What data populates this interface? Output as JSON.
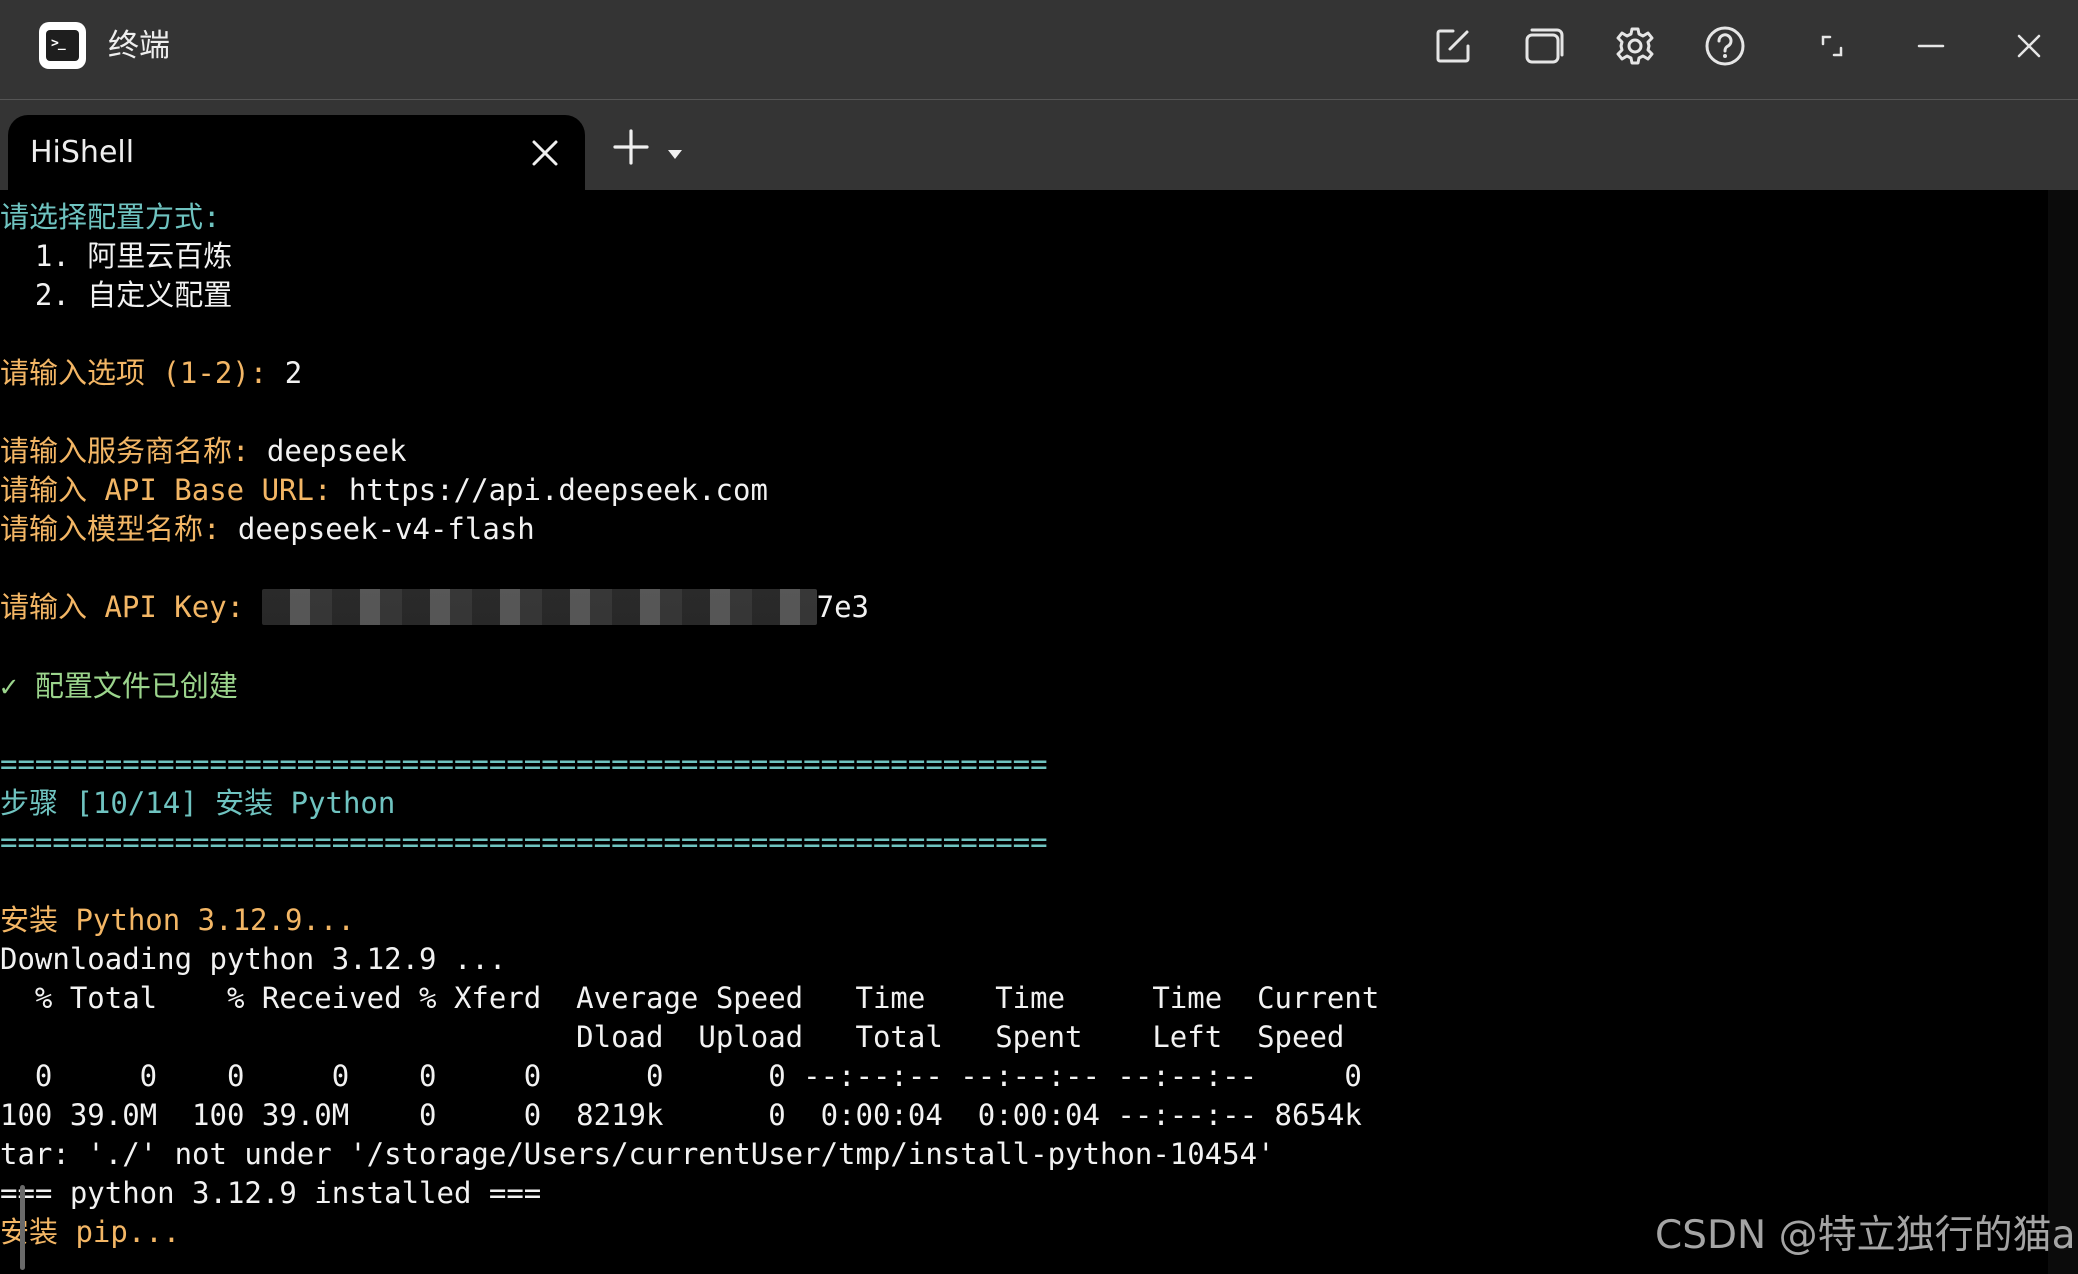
{
  "window": {
    "title": "终端",
    "icons": [
      "terminal-app-icon",
      "edit-square-icon",
      "window-duplicate-icon",
      "gear-icon",
      "help-circle-icon",
      "restore-window-icon",
      "minimize-icon",
      "close-icon"
    ]
  },
  "app_logo": {
    "prompt": ">_"
  },
  "tabs": [
    {
      "label": "HiShell"
    }
  ],
  "terminal": {
    "colors": {
      "cyan": "#6fc3c0",
      "orange": "#f3b665",
      "green": "#9bd48c",
      "white": "#f2f2f2"
    },
    "lines": [
      {
        "segments": [
          {
            "text": "请选择配置方式:",
            "color": "cyan"
          }
        ]
      },
      {
        "segments": [
          {
            "text": "  1. 阿里云百炼",
            "color": "white"
          }
        ]
      },
      {
        "segments": [
          {
            "text": "  2. 自定义配置",
            "color": "white"
          }
        ]
      },
      {
        "segments": []
      },
      {
        "segments": [
          {
            "text": "请输入选项 (1-2): ",
            "color": "orange"
          },
          {
            "text": "2",
            "color": "white"
          }
        ]
      },
      {
        "segments": []
      },
      {
        "segments": [
          {
            "text": "请输入服务商名称: ",
            "color": "orange"
          },
          {
            "text": "deepseek",
            "color": "white"
          }
        ]
      },
      {
        "segments": [
          {
            "text": "请输入 API Base URL: ",
            "color": "orange"
          },
          {
            "text": "https://api.deepseek.com",
            "color": "white"
          }
        ]
      },
      {
        "segments": [
          {
            "text": "请输入模型名称: ",
            "color": "orange"
          },
          {
            "text": "deepseek-v4-flash",
            "color": "white"
          }
        ]
      },
      {
        "segments": []
      },
      {
        "segments": [
          {
            "text": "请输入 API Key: ",
            "color": "orange"
          },
          {
            "text": "",
            "color": "white",
            "redacted": true
          },
          {
            "text": "7e3",
            "color": "white"
          }
        ]
      },
      {
        "segments": []
      },
      {
        "segments": [
          {
            "text": "✓ 配置文件已创建",
            "color": "green"
          }
        ]
      },
      {
        "segments": []
      },
      {
        "segments": [
          {
            "text": "============================================================",
            "color": "cyan"
          }
        ]
      },
      {
        "segments": [
          {
            "text": "步骤 [10/14] 安装 Python",
            "color": "cyan"
          }
        ]
      },
      {
        "segments": [
          {
            "text": "============================================================",
            "color": "cyan"
          }
        ]
      },
      {
        "segments": []
      },
      {
        "segments": [
          {
            "text": "安装 Python 3.12.9...",
            "color": "orange"
          }
        ]
      },
      {
        "segments": [
          {
            "text": "Downloading python 3.12.9 ...",
            "color": "white"
          }
        ]
      },
      {
        "segments": [
          {
            "text": "  % Total    % Received % Xferd  Average Speed   Time    Time     Time  Current",
            "color": "white"
          }
        ]
      },
      {
        "segments": [
          {
            "text": "                                 Dload  Upload   Total   Spent    Left  Speed",
            "color": "white"
          }
        ]
      },
      {
        "segments": [
          {
            "text": "  0     0    0     0    0     0      0      0 --:--:-- --:--:-- --:--:--     0",
            "color": "white"
          }
        ]
      },
      {
        "segments": [
          {
            "text": "100 39.0M  100 39.0M    0     0  8219k      0  0:00:04  0:00:04 --:--:-- 8654k",
            "color": "white"
          }
        ]
      },
      {
        "segments": [
          {
            "text": "tar: './' not under '/storage/Users/currentUser/tmp/install-python-10454'",
            "color": "white"
          }
        ]
      },
      {
        "segments": [
          {
            "text": "=== python 3.12.9 installed ===",
            "color": "white"
          }
        ]
      },
      {
        "segments": [
          {
            "text": "安装 pip...",
            "color": "orange"
          }
        ]
      }
    ]
  },
  "watermark": "CSDN @特立独行的猫a"
}
